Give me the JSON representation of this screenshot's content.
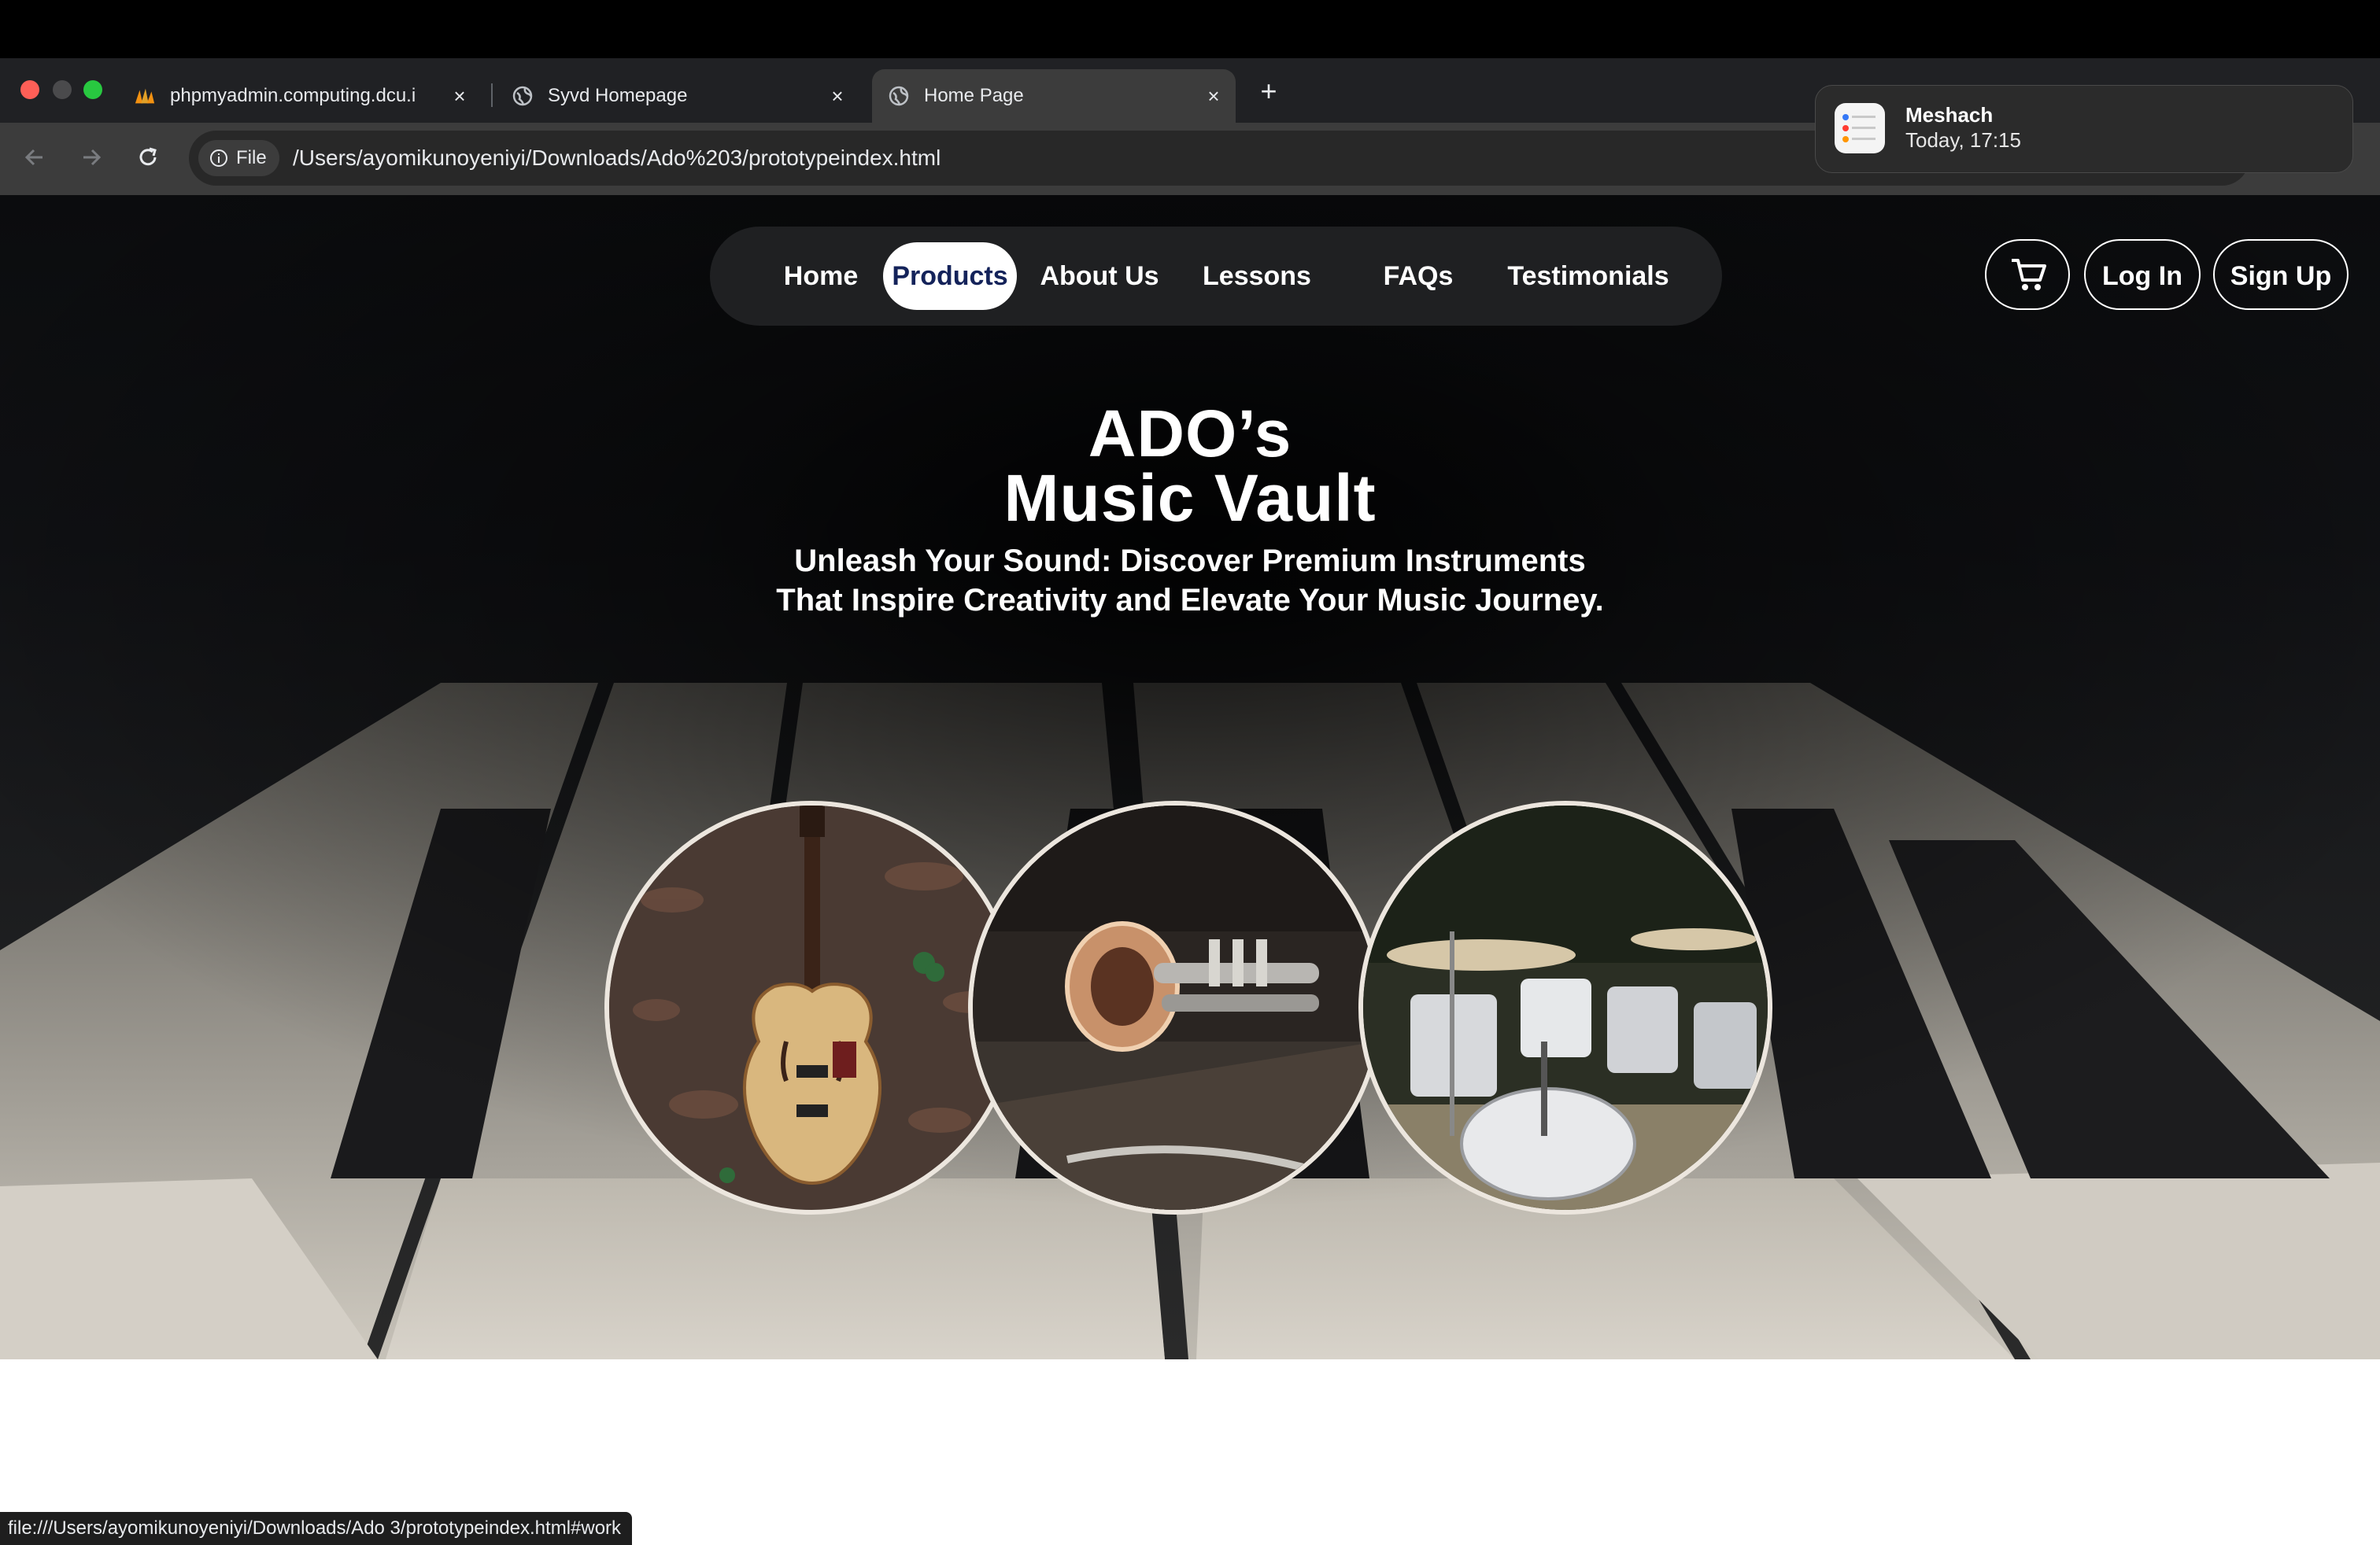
{
  "browser": {
    "tabs": [
      {
        "title": "phpmyadmin.computing.dcu.i",
        "icon": "phpmyadmin-icon",
        "active": false
      },
      {
        "title": "Syvd Homepage",
        "icon": "globe-icon",
        "active": false
      },
      {
        "title": "Home Page",
        "icon": "globe-icon",
        "active": true
      }
    ],
    "address_chip": "File",
    "url": "/Users/ayomikunoyeniyi/Downloads/Ado%203/prototypeindex.html",
    "status_url": "file:///Users/ayomikunoyeniyi/Downloads/Ado 3/prototypeindex.html#work"
  },
  "notification": {
    "title": "Meshach",
    "time": "Today, 17:15",
    "icon": "reminders-icon"
  },
  "site": {
    "nav": [
      {
        "label": "Home",
        "active": false
      },
      {
        "label": "Products",
        "active": true
      },
      {
        "label": "About Us",
        "active": false
      },
      {
        "label": "Lessons",
        "active": false
      },
      {
        "label": "FAQs",
        "active": false
      },
      {
        "label": "Testimonials",
        "active": false
      }
    ],
    "cart_icon": "cart-icon",
    "login_label": "Log In",
    "signup_label": "Sign Up",
    "hero": {
      "title_line1": "ADO’s",
      "title_line2": "Music Vault",
      "subtitle_line1": "Unleash Your Sound: Discover Premium Instruments",
      "subtitle_line2": "That Inspire Creativity and Elevate Your Music Journey."
    },
    "instruments": [
      "guitar",
      "trumpet",
      "drum kit"
    ],
    "colors": {
      "active_nav_text": "#14235a",
      "nav_pill_bg": "#1f2022"
    }
  }
}
